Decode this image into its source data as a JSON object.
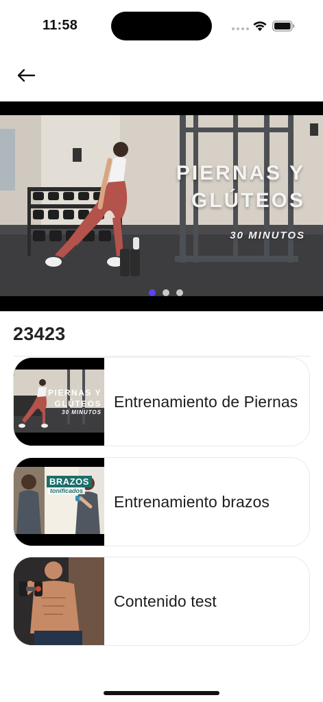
{
  "status_bar": {
    "time": "11:58"
  },
  "header": {
    "back_icon": "arrow-left-icon"
  },
  "hero": {
    "title_line1": "PIERNAS Y",
    "title_line2": "GLÚTEOS",
    "subtitle": "30 MINUTOS",
    "pages": 3,
    "active_page": 1,
    "active_dot_color": "#5a46f0"
  },
  "section": {
    "title": "23423"
  },
  "videos": [
    {
      "title": "Entrenamiento de Piernas",
      "thumb_text_line1": "PIERNAS Y",
      "thumb_text_line2": "GLÚTEOS",
      "thumb_subtitle": "30 MINUTOS"
    },
    {
      "title": "Entrenamiento brazos",
      "thumb_badge": "BRAZOS",
      "thumb_sub": "tonificados"
    },
    {
      "title": "Contenido test"
    }
  ]
}
